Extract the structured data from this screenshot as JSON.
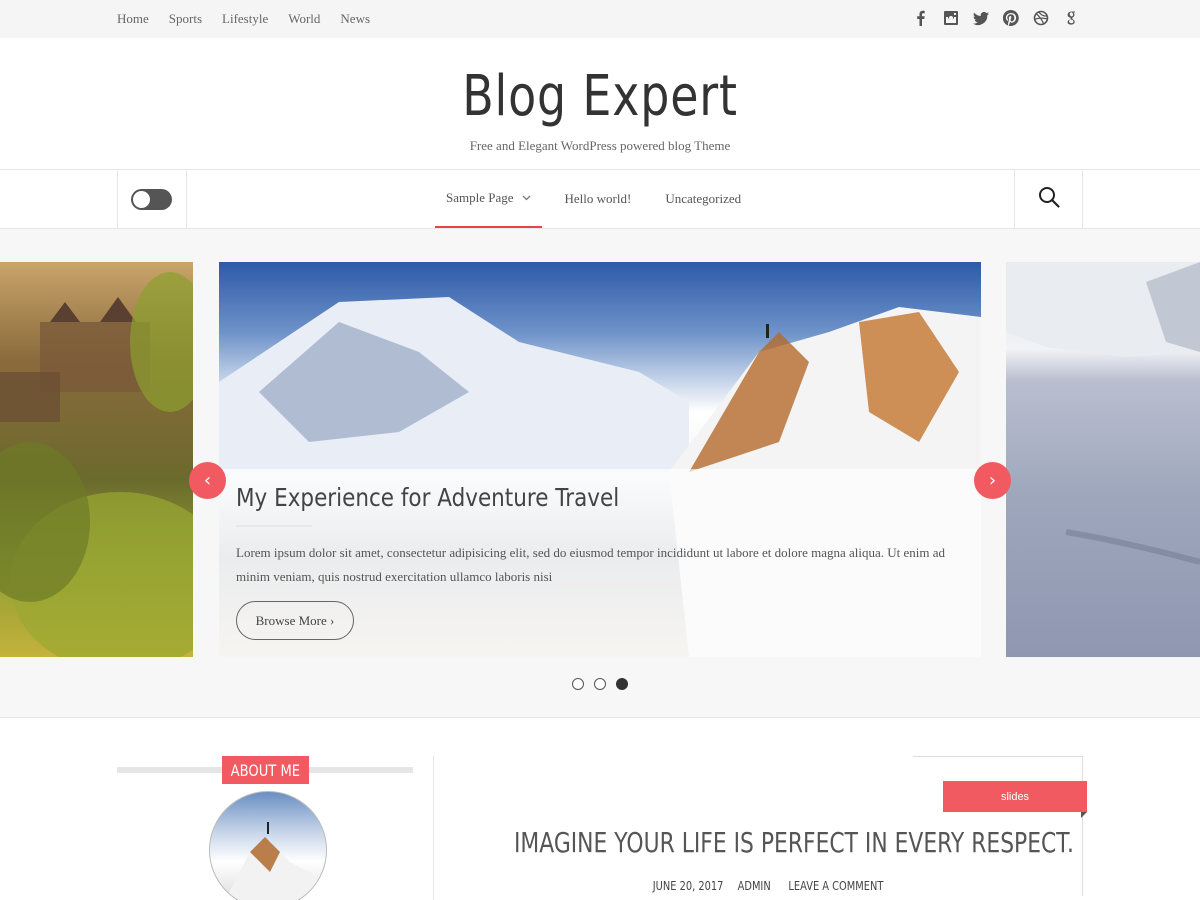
{
  "topbar": {
    "nav": [
      "Home",
      "Sports",
      "Lifestyle",
      "World",
      "News"
    ],
    "social_icons": [
      "facebook-icon",
      "instagram-icon",
      "twitter-icon",
      "pinterest-icon",
      "dribbble-icon",
      "google-plus-icon"
    ]
  },
  "header": {
    "site_title": "Blog Expert",
    "tagline": "Free and Elegant WordPress powered blog Theme"
  },
  "mainnav": {
    "items": [
      {
        "label": "Sample Page",
        "has_dropdown": true,
        "active": true
      },
      {
        "label": "Hello world!",
        "has_dropdown": false,
        "active": false
      },
      {
        "label": "Uncategorized",
        "has_dropdown": false,
        "active": false
      }
    ],
    "toggle_state": "off"
  },
  "slider": {
    "title": "My Experience for Adventure Travel",
    "text": "Lorem ipsum dolor sit amet, consectetur adipisicing elit, sed do eiusmod tempor incididunt ut labore et dolore magna aliqua. Ut enim ad minim veniam, quis nostrud exercitation ullamco laboris nisi",
    "button": "Browse More ›",
    "prev": "‹",
    "next": "›",
    "dots": 3,
    "active_dot": 3
  },
  "sidebar": {
    "about_label": "ABOUT ME"
  },
  "post": {
    "tag": "slides",
    "title": "IMAGINE YOUR LIFE IS PERFECT IN EVERY RESPECT.",
    "date": "JUNE 20, 2017",
    "author": "ADMIN",
    "comment_link": "LEAVE A COMMENT"
  },
  "colors": {
    "accent": "#f05a60",
    "topbar_bg": "#f5f5f5",
    "slider_bg": "#f7f7f7"
  }
}
